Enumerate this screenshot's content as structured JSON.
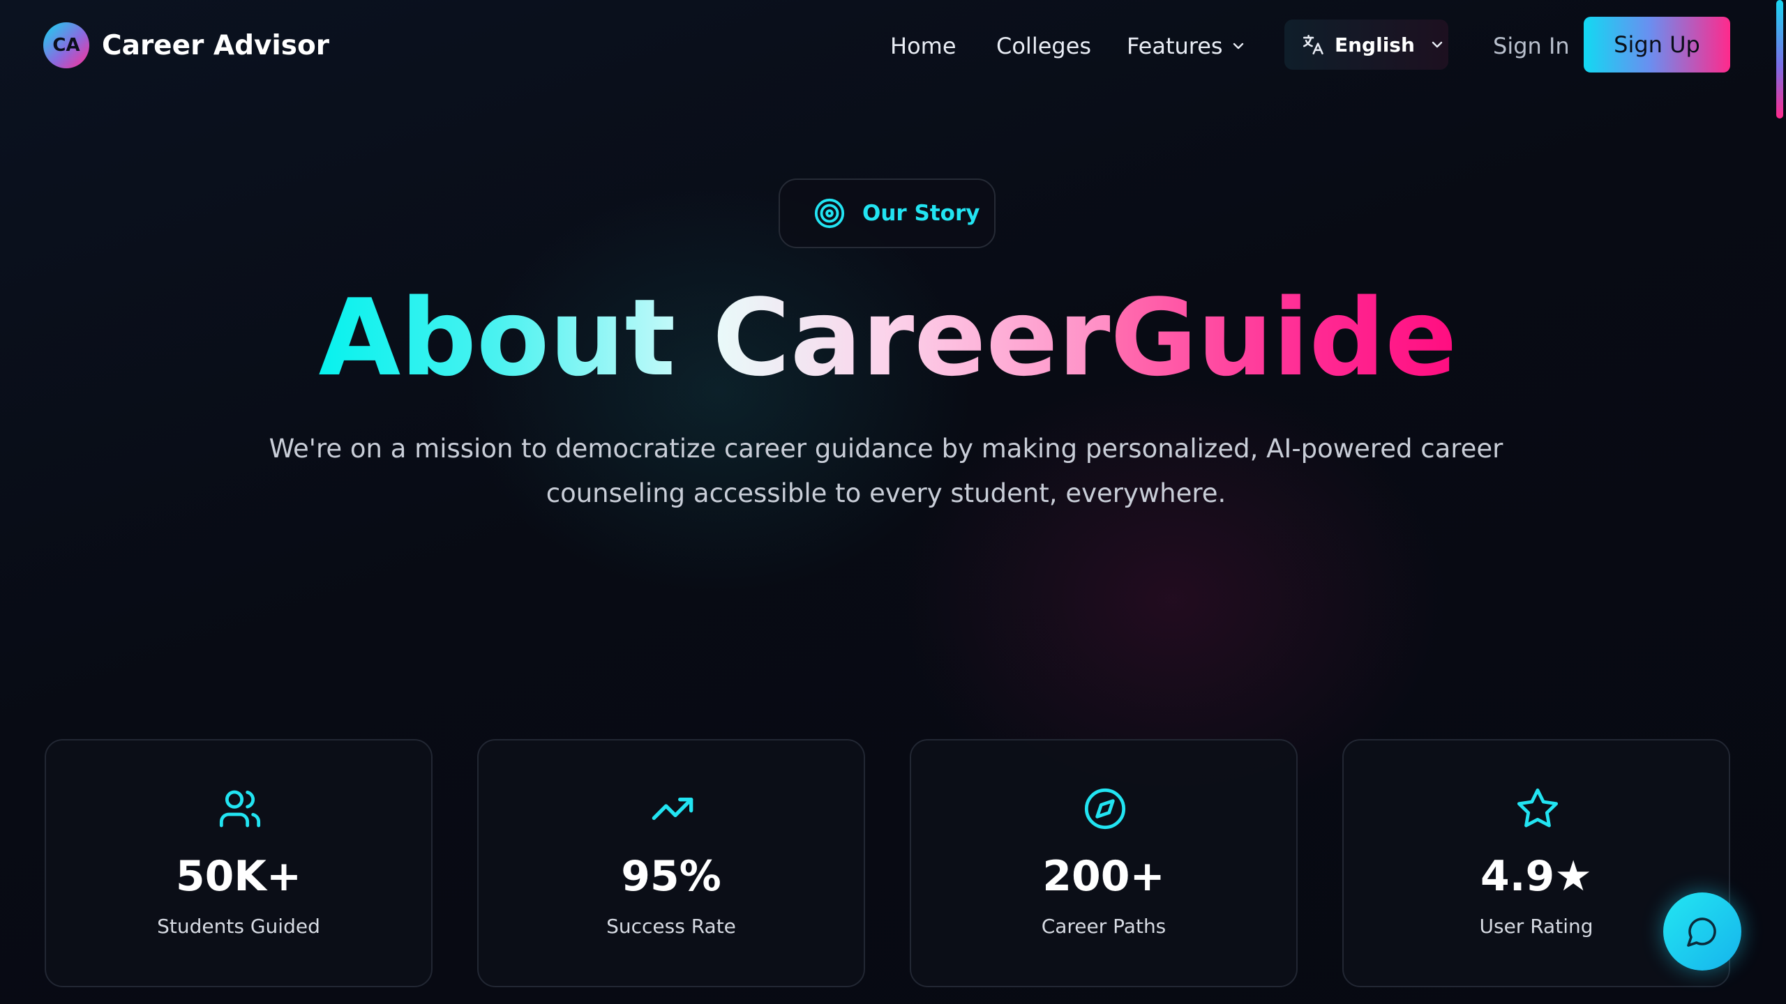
{
  "header": {
    "logo_initials": "CA",
    "app_name": "Career Advisor",
    "nav": {
      "home": "Home",
      "colleges": "Colleges",
      "features": "Features"
    },
    "language": {
      "selected": "English",
      "icon": "translate-icon"
    },
    "sign_in": "Sign In",
    "sign_up": "Sign Up"
  },
  "hero": {
    "badge_label": "Our Story",
    "badge_icon": "target-icon",
    "title_part1": "About ",
    "title_part2": "Career",
    "title_part3": "Guide",
    "subtitle_line1": "We're on a mission to democratize career guidance by making personalized, AI-powered career",
    "subtitle_line2": "counseling accessible to every student, everywhere."
  },
  "stats": [
    {
      "icon": "users-icon",
      "value": "50K+",
      "label": "Students Guided"
    },
    {
      "icon": "trending-up-icon",
      "value": "95%",
      "label": "Success Rate"
    },
    {
      "icon": "compass-icon",
      "value": "200+",
      "label": "Career Paths"
    },
    {
      "icon": "star-icon",
      "value": "4.9★",
      "label": "User Rating"
    }
  ],
  "colors": {
    "accent_cyan": "#22e4f2",
    "accent_pink": "#ff2a8c",
    "background": "#080b14"
  },
  "chat_button_icon": "chat-bubble-icon"
}
